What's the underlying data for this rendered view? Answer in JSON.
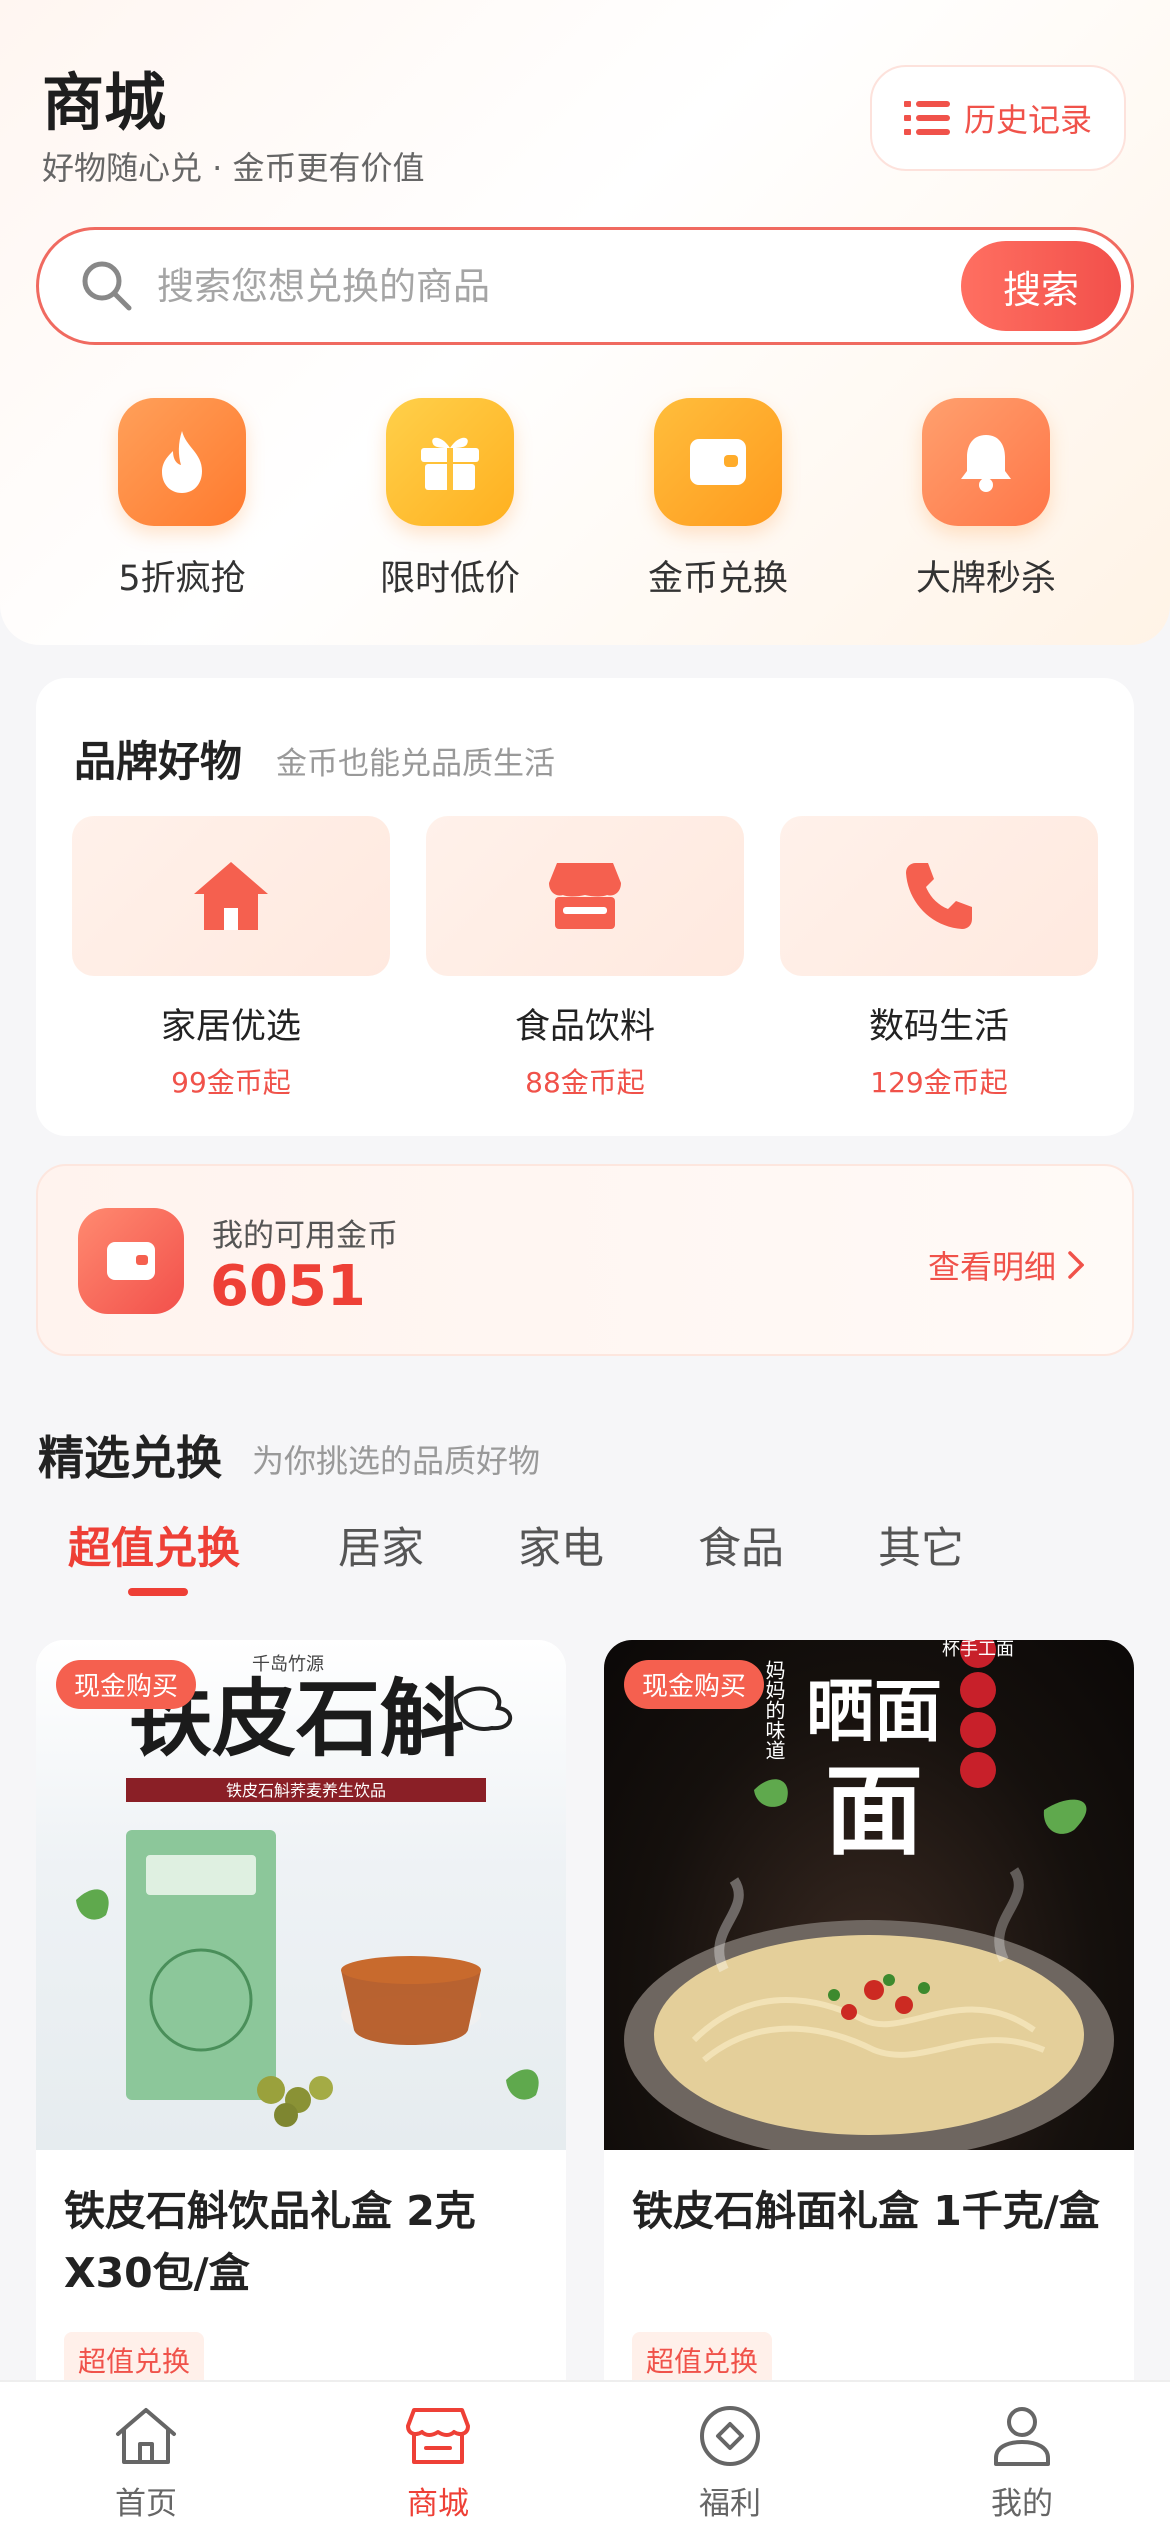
{
  "header": {
    "title": "商城",
    "subtitle": "好物随心兑 · 金币更有价值",
    "history_label": "历史记录"
  },
  "search": {
    "placeholder": "搜索您想兑换的商品",
    "button_label": "搜索"
  },
  "quick_actions": [
    {
      "label": "5折疯抢",
      "icon": "flame-icon",
      "color": "#ff8a3d"
    },
    {
      "label": "限时低价",
      "icon": "gift-icon",
      "color": "#ffb730"
    },
    {
      "label": "金币兑换",
      "icon": "wallet-icon",
      "color": "#ffa726"
    },
    {
      "label": "大牌秒杀",
      "icon": "bell-icon",
      "color": "#ff8a5c"
    }
  ],
  "brand": {
    "title": "品牌好物",
    "subtitle": "金币也能兑品质生活",
    "items": [
      {
        "name": "家居优选",
        "price": "99金币起",
        "icon": "home-icon"
      },
      {
        "name": "食品饮料",
        "price": "88金币起",
        "icon": "store-icon"
      },
      {
        "name": "数码生活",
        "price": "129金币起",
        "icon": "phone-icon"
      }
    ]
  },
  "coins": {
    "label": "我的可用金币",
    "value": "6051",
    "detail_link": "查看明细"
  },
  "featured": {
    "title": "精选兑换",
    "subtitle": "为你挑选的品质好物",
    "tabs": [
      "超值兑换",
      "居家",
      "家电",
      "食品",
      "其它"
    ],
    "active_tab": 0,
    "products": [
      {
        "badge": "现金购买",
        "name": "铁皮石斛饮品礼盒 2克X30包/盒",
        "tag": "超值兑换",
        "image_text_main": "铁皮石斛",
        "image_text_brand": "千岛竹源",
        "image_text_banner": "铁皮石斛荞麦养生饮品"
      },
      {
        "badge": "现金购买",
        "name": "铁皮石斛面礼盒 1千克/盒",
        "tag": "超值兑换",
        "image_text_main": "晒面",
        "image_text_sub": "面",
        "image_text_vertical": "妈妈的味道",
        "image_text_side": "杯手工面"
      }
    ]
  },
  "bottom_nav": [
    {
      "label": "首页",
      "icon": "home-outline-icon"
    },
    {
      "label": "商城",
      "icon": "store-outline-icon"
    },
    {
      "label": "福利",
      "icon": "welfare-icon"
    },
    {
      "label": "我的",
      "icon": "profile-icon"
    }
  ],
  "active_nav": 1,
  "colors": {
    "accent": "#ee4036",
    "accent_light": "#fff0ea",
    "background": "#f6f6f8"
  }
}
